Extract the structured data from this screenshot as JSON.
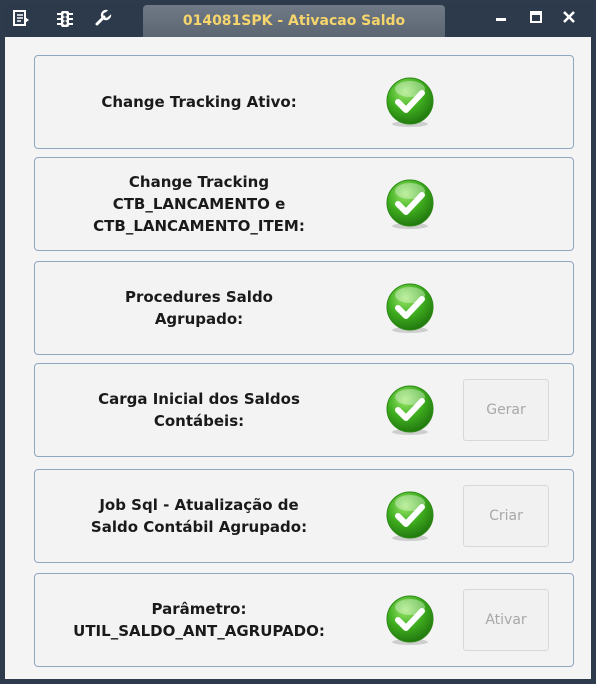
{
  "window": {
    "title": "014081SPK - Ativacao Saldo",
    "controls": {
      "minimize": "▬",
      "maximize": "☐",
      "close": "✕"
    }
  },
  "rows": [
    {
      "label_lines": [
        "Change Tracking Ativo:"
      ],
      "status_icon": "check-circle-icon",
      "button": null
    },
    {
      "label_lines": [
        "Change Tracking",
        "CTB_LANCAMENTO e",
        "CTB_LANCAMENTO_ITEM:"
      ],
      "status_icon": "check-circle-icon",
      "button": null
    },
    {
      "label_lines": [
        "Procedures Saldo",
        "Agrupado:"
      ],
      "status_icon": "check-circle-icon",
      "button": null
    },
    {
      "label_lines": [
        "Carga Inicial dos Saldos",
        "Contábeis:"
      ],
      "status_icon": "check-circle-icon",
      "button": "Gerar"
    },
    {
      "label_lines": [
        "Job Sql - Atualização de",
        "Saldo Contábil Agrupado:"
      ],
      "status_icon": "check-circle-icon",
      "button": "Criar"
    },
    {
      "label_lines": [
        "Parâmetro:",
        "UTIL_SALDO_ANT_AGRUPADO:"
      ],
      "status_icon": "check-circle-icon",
      "button": "Ativar"
    }
  ],
  "colors": {
    "titlebar": "#2c3a4b",
    "title_text": "#f6d56c",
    "panel_border": "#8fa7c0",
    "check_green": "#3fae1f"
  }
}
